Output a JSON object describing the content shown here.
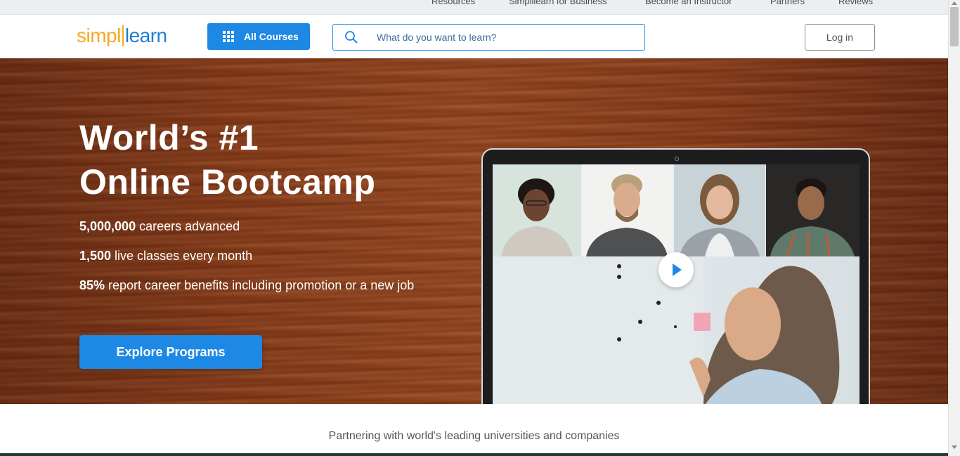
{
  "topbar": {
    "links": [
      "Resources",
      "Simplilearn for Business",
      "Become an Instructor",
      "Partners",
      "Reviews"
    ]
  },
  "header": {
    "logo_part1": "simpl",
    "logo_part2": "learn",
    "all_courses_label": "All Courses",
    "search_placeholder": "What do you want to learn?",
    "login_label": "Log in"
  },
  "hero": {
    "title_line1": "World’s #1",
    "title_line2": "Online Bootcamp",
    "stats": [
      {
        "value": "5,000,000",
        "text": " careers advanced"
      },
      {
        "value": "1,500",
        "text": " live classes every month"
      },
      {
        "value": "85%",
        "text": " report career benefits including promotion or a new job"
      }
    ],
    "cta_label": "Explore Programs"
  },
  "partners": {
    "heading": "Partnering with world's leading universities and companies"
  },
  "colors": {
    "accent": "#1e88e5",
    "logo_orange": "#f6a821",
    "logo_blue": "#1c7ed6",
    "hero_wood": "#8a3e1b"
  },
  "icons": [
    "grid-icon",
    "search-icon",
    "play-icon"
  ]
}
